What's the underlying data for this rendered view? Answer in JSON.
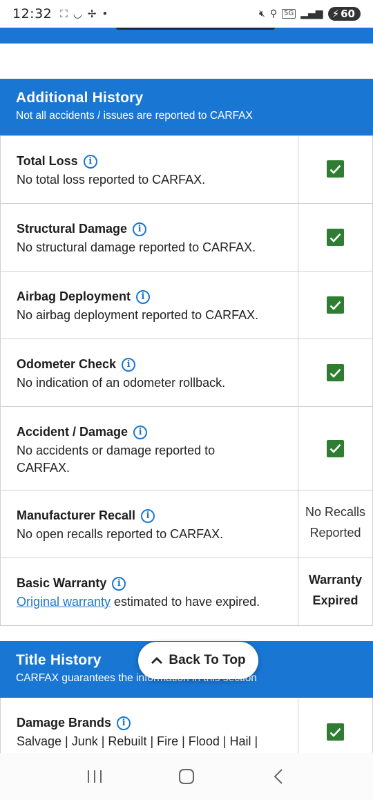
{
  "status": {
    "time": "12:32",
    "network": "5G",
    "battery": "60"
  },
  "additional_history": {
    "title": "Additional History",
    "subtitle": "Not all accidents / issues are reported to CARFAX",
    "rows": [
      {
        "title": "Total Loss",
        "desc": "No total loss reported to CARFAX.",
        "status": "check"
      },
      {
        "title": "Structural Damage",
        "desc": "No structural damage reported to CARFAX.",
        "status": "check"
      },
      {
        "title": "Airbag Deployment",
        "desc": "No airbag deployment reported to CARFAX.",
        "status": "check"
      },
      {
        "title": "Odometer Check",
        "desc": "No indication of an odometer rollback.",
        "status": "check"
      },
      {
        "title": "Accident / Damage",
        "desc": "No accidents or damage reported to CARFAX.",
        "status": "check"
      },
      {
        "title": "Manufacturer Recall",
        "desc": "No open recalls reported to CARFAX.",
        "right_text": "No Recalls Reported"
      },
      {
        "title": "Basic Warranty",
        "desc_link": "Original warranty",
        "desc_rest": " estimated to have expired.",
        "right_text": "Warranty Expired"
      }
    ]
  },
  "title_history": {
    "title": "Title History",
    "subtitle": "CARFAX guarantees the information in this section",
    "rows": [
      {
        "title": "Damage Brands",
        "desc": "Salvage | Junk | Rebuilt | Fire | Flood | Hail |",
        "status": "check"
      }
    ]
  },
  "back_to_top": {
    "label": "Back To Top"
  },
  "colors": {
    "accent": "#1976d2",
    "check": "#2e7d32"
  }
}
